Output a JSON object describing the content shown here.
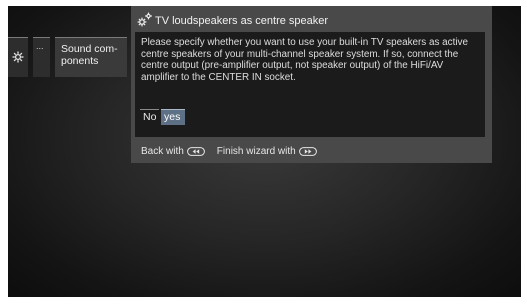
{
  "menu": {
    "settings_icon": "gear-icon",
    "more_label": "...",
    "sound_label": "Sound com-\nponents"
  },
  "dialog": {
    "icon": "gears-icon",
    "title": "TV loudspeakers as centre speaker",
    "text": "Please specify whether you want to use your built-in TV speakers as active centre speakers of your multi-channel speaker system. If so, connect the centre output (pre-amplifier output, not speaker output) of the HiFi/AV amplifier to the CENTER IN socket.",
    "options": [
      {
        "label": "No",
        "selected": false
      },
      {
        "label": "yes",
        "selected": true
      }
    ]
  },
  "footer": {
    "back_label": "Back with",
    "back_key_icon": "rewind-key-icon",
    "finish_label": "Finish wizard with",
    "finish_key_icon": "forward-key-icon"
  },
  "colors": {
    "dialog_bg": "#494949",
    "body_bg": "#1b1b1b",
    "selected_bg": "#5d7085"
  }
}
